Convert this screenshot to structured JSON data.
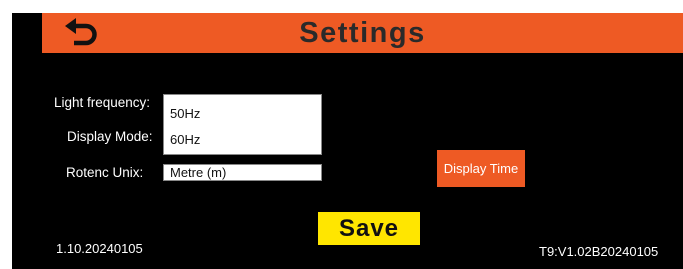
{
  "header": {
    "title": "Settings",
    "back_icon": "back-arrow-icon",
    "accent_color": "#ee5a24"
  },
  "form": {
    "light_frequency_label": "Light frequency:",
    "display_mode_label": "Display Mode:",
    "rotenc_unix_label": "Rotenc Unix:",
    "frequency_options": [
      "50Hz",
      "60Hz"
    ],
    "rotenc_unix_value": "Metre (m)"
  },
  "buttons": {
    "display_time": "Display Time",
    "save": "Save",
    "save_color": "#ffe600"
  },
  "footer": {
    "version_left": "1.10.20240105",
    "version_right": "T9:V1.02B20240105"
  }
}
